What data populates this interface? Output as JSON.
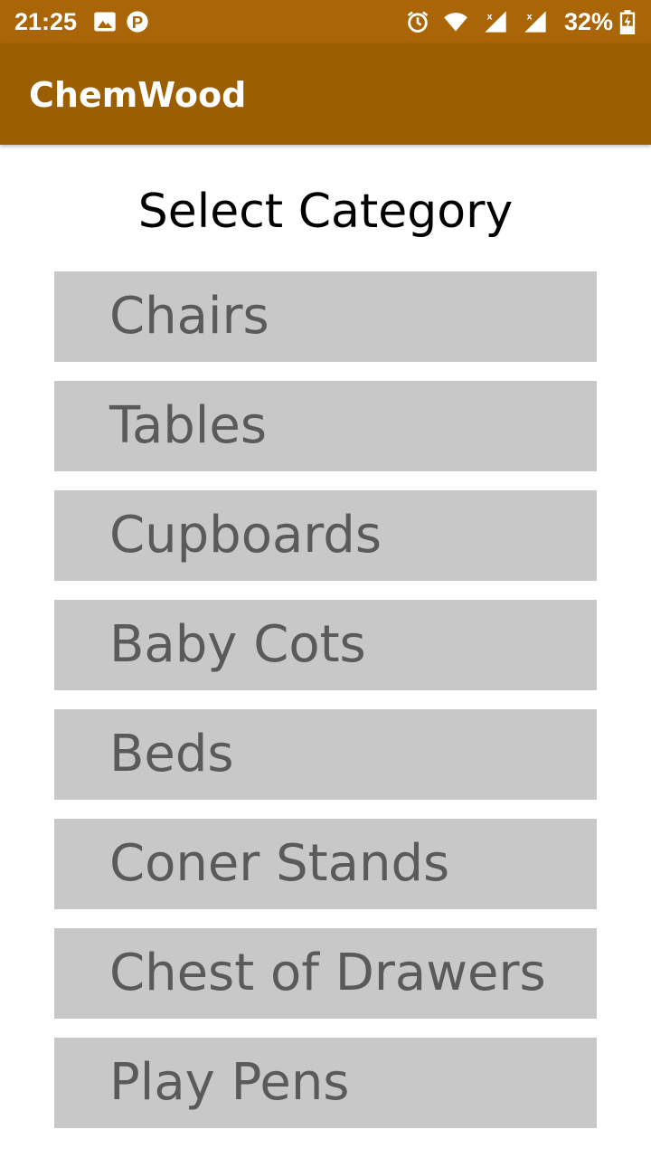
{
  "status_bar": {
    "time": "21:25",
    "battery_percent": "32%",
    "icons": [
      "image-icon",
      "parking-icon",
      "alarm-icon",
      "wifi-icon",
      "signal-icon",
      "signal-icon",
      "battery-charging-icon"
    ],
    "color": "#aa6606"
  },
  "app_bar": {
    "title": "ChemWood",
    "color": "#9b5e01"
  },
  "main": {
    "title": "Select Category",
    "categories": [
      {
        "label": "Chairs"
      },
      {
        "label": "Tables"
      },
      {
        "label": "Cupboards"
      },
      {
        "label": "Baby Cots"
      },
      {
        "label": "Beds"
      },
      {
        "label": "Coner Stands"
      },
      {
        "label": "Chest of Drawers"
      },
      {
        "label": "Play Pens"
      }
    ],
    "button_color": "#c8c8c8",
    "button_text_color": "#5a5a5a"
  }
}
